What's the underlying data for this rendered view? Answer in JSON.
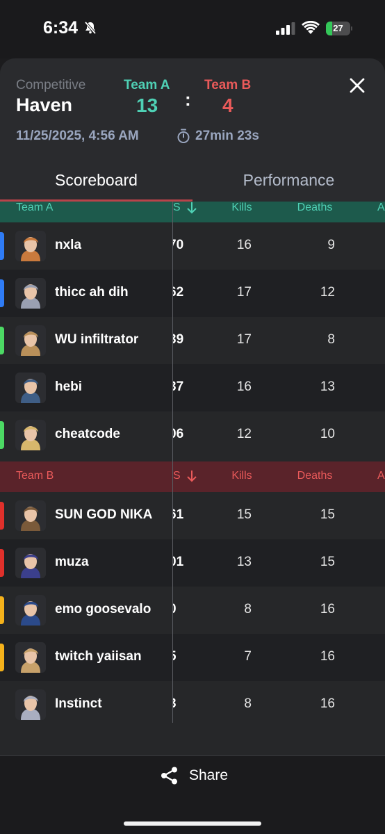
{
  "status_bar": {
    "time": "6:34",
    "battery_text": "27",
    "battery_level": 0.27,
    "battery_color": "#34c759"
  },
  "header": {
    "mode": "Competitive",
    "map": "Haven",
    "team_a_name": "Team A",
    "team_a_score": "13",
    "colon": ":",
    "team_b_name": "Team B",
    "team_b_score": "4",
    "date": "11/25/2025, 4:56 AM",
    "duration": "27min 23s",
    "team_a_color": "#4fd1b5",
    "team_b_color": "#ea5a5a"
  },
  "tabs": [
    {
      "label": "Scoreboard",
      "active": true
    },
    {
      "label": "Performance",
      "active": false
    }
  ],
  "columns": {
    "score_partial": "S",
    "score_partial_b": "S",
    "kills": "Kills",
    "deaths": "Deaths",
    "assists_partial": "A"
  },
  "team_a": {
    "label": "Team A",
    "header_bg": "#1d5a4c",
    "header_fg": "#4fd1b5",
    "players": [
      {
        "name": "nxla",
        "score": "70",
        "kills": "16",
        "deaths": "9",
        "party_color": "#2f7cf6",
        "avatar": "agent-portrait-icon"
      },
      {
        "name": "thicc ah dih",
        "score": "62",
        "kills": "17",
        "deaths": "12",
        "party_color": "#2f7cf6",
        "avatar": "agent-portrait-icon"
      },
      {
        "name": "WU infiltrator",
        "score": "39",
        "kills": "17",
        "deaths": "8",
        "party_color": "#4cd964",
        "avatar": "agent-portrait-icon"
      },
      {
        "name": "hebi",
        "score": "37",
        "kills": "16",
        "deaths": "13",
        "party_color": "",
        "avatar": "agent-portrait-icon"
      },
      {
        "name": "cheatcode",
        "score": "06",
        "kills": "12",
        "deaths": "10",
        "party_color": "#4cd964",
        "avatar": "agent-portrait-icon"
      }
    ]
  },
  "team_b": {
    "label": "Team B",
    "header_bg": "#5a232a",
    "header_fg": "#ea5a5a",
    "players": [
      {
        "name": "SUN GOD NIKA",
        "score": "61",
        "kills": "15",
        "deaths": "15",
        "party_color": "#e0302b",
        "avatar": "agent-portrait-icon"
      },
      {
        "name": "muza",
        "score": "01",
        "kills": "13",
        "deaths": "15",
        "party_color": "#e0302b",
        "avatar": "agent-portrait-icon"
      },
      {
        "name": "emo goosevalo",
        "score": "0",
        "kills": "8",
        "deaths": "16",
        "party_color": "#f5b21b",
        "avatar": "agent-portrait-icon"
      },
      {
        "name": "twitch yaiisan",
        "score": "5",
        "kills": "7",
        "deaths": "16",
        "party_color": "#f5b21b",
        "avatar": "agent-portrait-icon"
      },
      {
        "name": "Instinct",
        "score": "3",
        "kills": "8",
        "deaths": "16",
        "party_color": "",
        "avatar": "agent-portrait-icon"
      }
    ]
  },
  "footer": {
    "share_label": "Share"
  }
}
